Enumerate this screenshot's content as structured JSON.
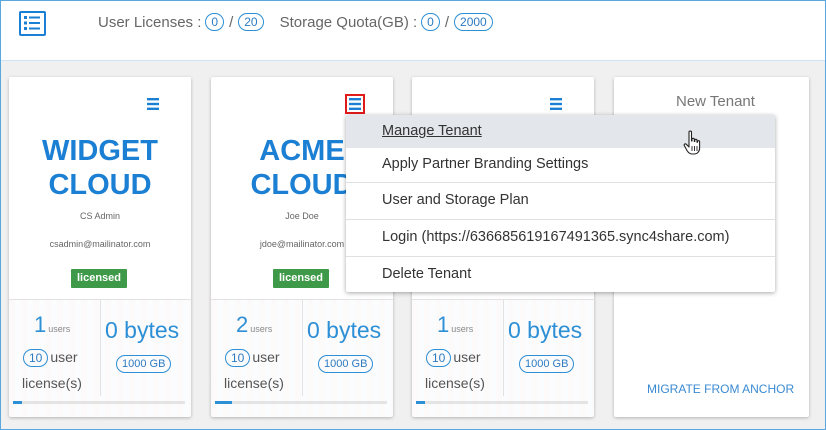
{
  "header": {
    "user_licenses_label": "User Licenses :",
    "user_licenses_used": "0",
    "user_licenses_total": "20",
    "storage_label": "Storage Quota(GB) :",
    "storage_used": "0",
    "storage_total": "2000",
    "separator": "/"
  },
  "tenants": [
    {
      "name_line1": "WIDGET",
      "name_line2": "CLOUD",
      "admin": "CS Admin",
      "email": "csadmin@mailinator.com",
      "status": "licensed",
      "users_count": "1",
      "users_unit": "users",
      "licenses": "10",
      "license_label_1": "user",
      "license_label_2": "license(s)",
      "storage_used": "0 bytes",
      "storage_quota": "1000 GB",
      "usage_fraction": 0.05
    },
    {
      "name_line1": "ACME",
      "name_line2": "CLOUD",
      "admin": "Joe Doe",
      "email": "jdoe@mailinator.com",
      "status": "licensed",
      "users_count": "2",
      "users_unit": "users",
      "licenses": "10",
      "license_label_1": "user",
      "license_label_2": "license(s)",
      "storage_used": "0 bytes",
      "storage_quota": "1000 GB",
      "usage_fraction": 0.1
    },
    {
      "users_count": "1",
      "users_unit": "users",
      "licenses": "10",
      "license_label_1": "user",
      "license_label_2": "license(s)",
      "storage_used": "0 bytes",
      "storage_quota": "1000 GB",
      "usage_fraction": 0.05
    }
  ],
  "new_tenant": {
    "title": "New Tenant",
    "migrate_link": "MIGRATE FROM ANCHOR"
  },
  "menu": {
    "items": [
      "Manage Tenant",
      "Apply Partner Branding Settings",
      "User and Storage Plan",
      "Login (https://636685619167491365.sync4share.com)",
      "Delete Tenant"
    ]
  },
  "colors": {
    "accent": "#1b7fd3",
    "licensed_badge": "#3e9a48",
    "menu_highlight": "#e01b1b",
    "hover_row": "#e3e6ea"
  },
  "icons": [
    "list-icon",
    "hamburger-menu-icon",
    "hand-pointer-cursor-icon"
  ]
}
